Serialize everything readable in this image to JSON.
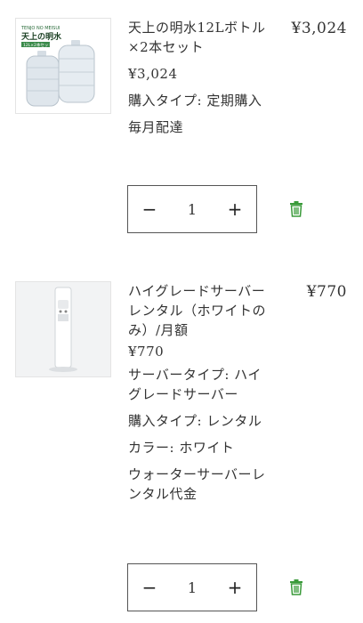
{
  "cart": {
    "items": [
      {
        "image_label_top": "TENJO NO MEISUI",
        "image_label_main": "天上の明水",
        "image_label_sub": "12L×2本セット",
        "title": "天上の明水12Lボトル×2本セット",
        "price": "¥3,024",
        "details": [
          "購入タイプ: 定期購入",
          "毎月配達"
        ],
        "line_total": "¥3,024",
        "quantity": "1",
        "minus_label": "−",
        "plus_label": "+"
      },
      {
        "title": "ハイグレードサーバーレンタル（ホワイトのみ）/月額",
        "price": "¥770",
        "details": [
          "サーバータイプ: ハイグレードサーバー",
          "購入タイプ: レンタル",
          "カラー: ホワイト",
          "ウォーターサーバーレンタル代金"
        ],
        "line_total": "¥770",
        "quantity": "1",
        "minus_label": "−",
        "plus_label": "+"
      }
    ]
  },
  "colors": {
    "trash_icon": "#3a9a3a",
    "border": "#555555"
  }
}
